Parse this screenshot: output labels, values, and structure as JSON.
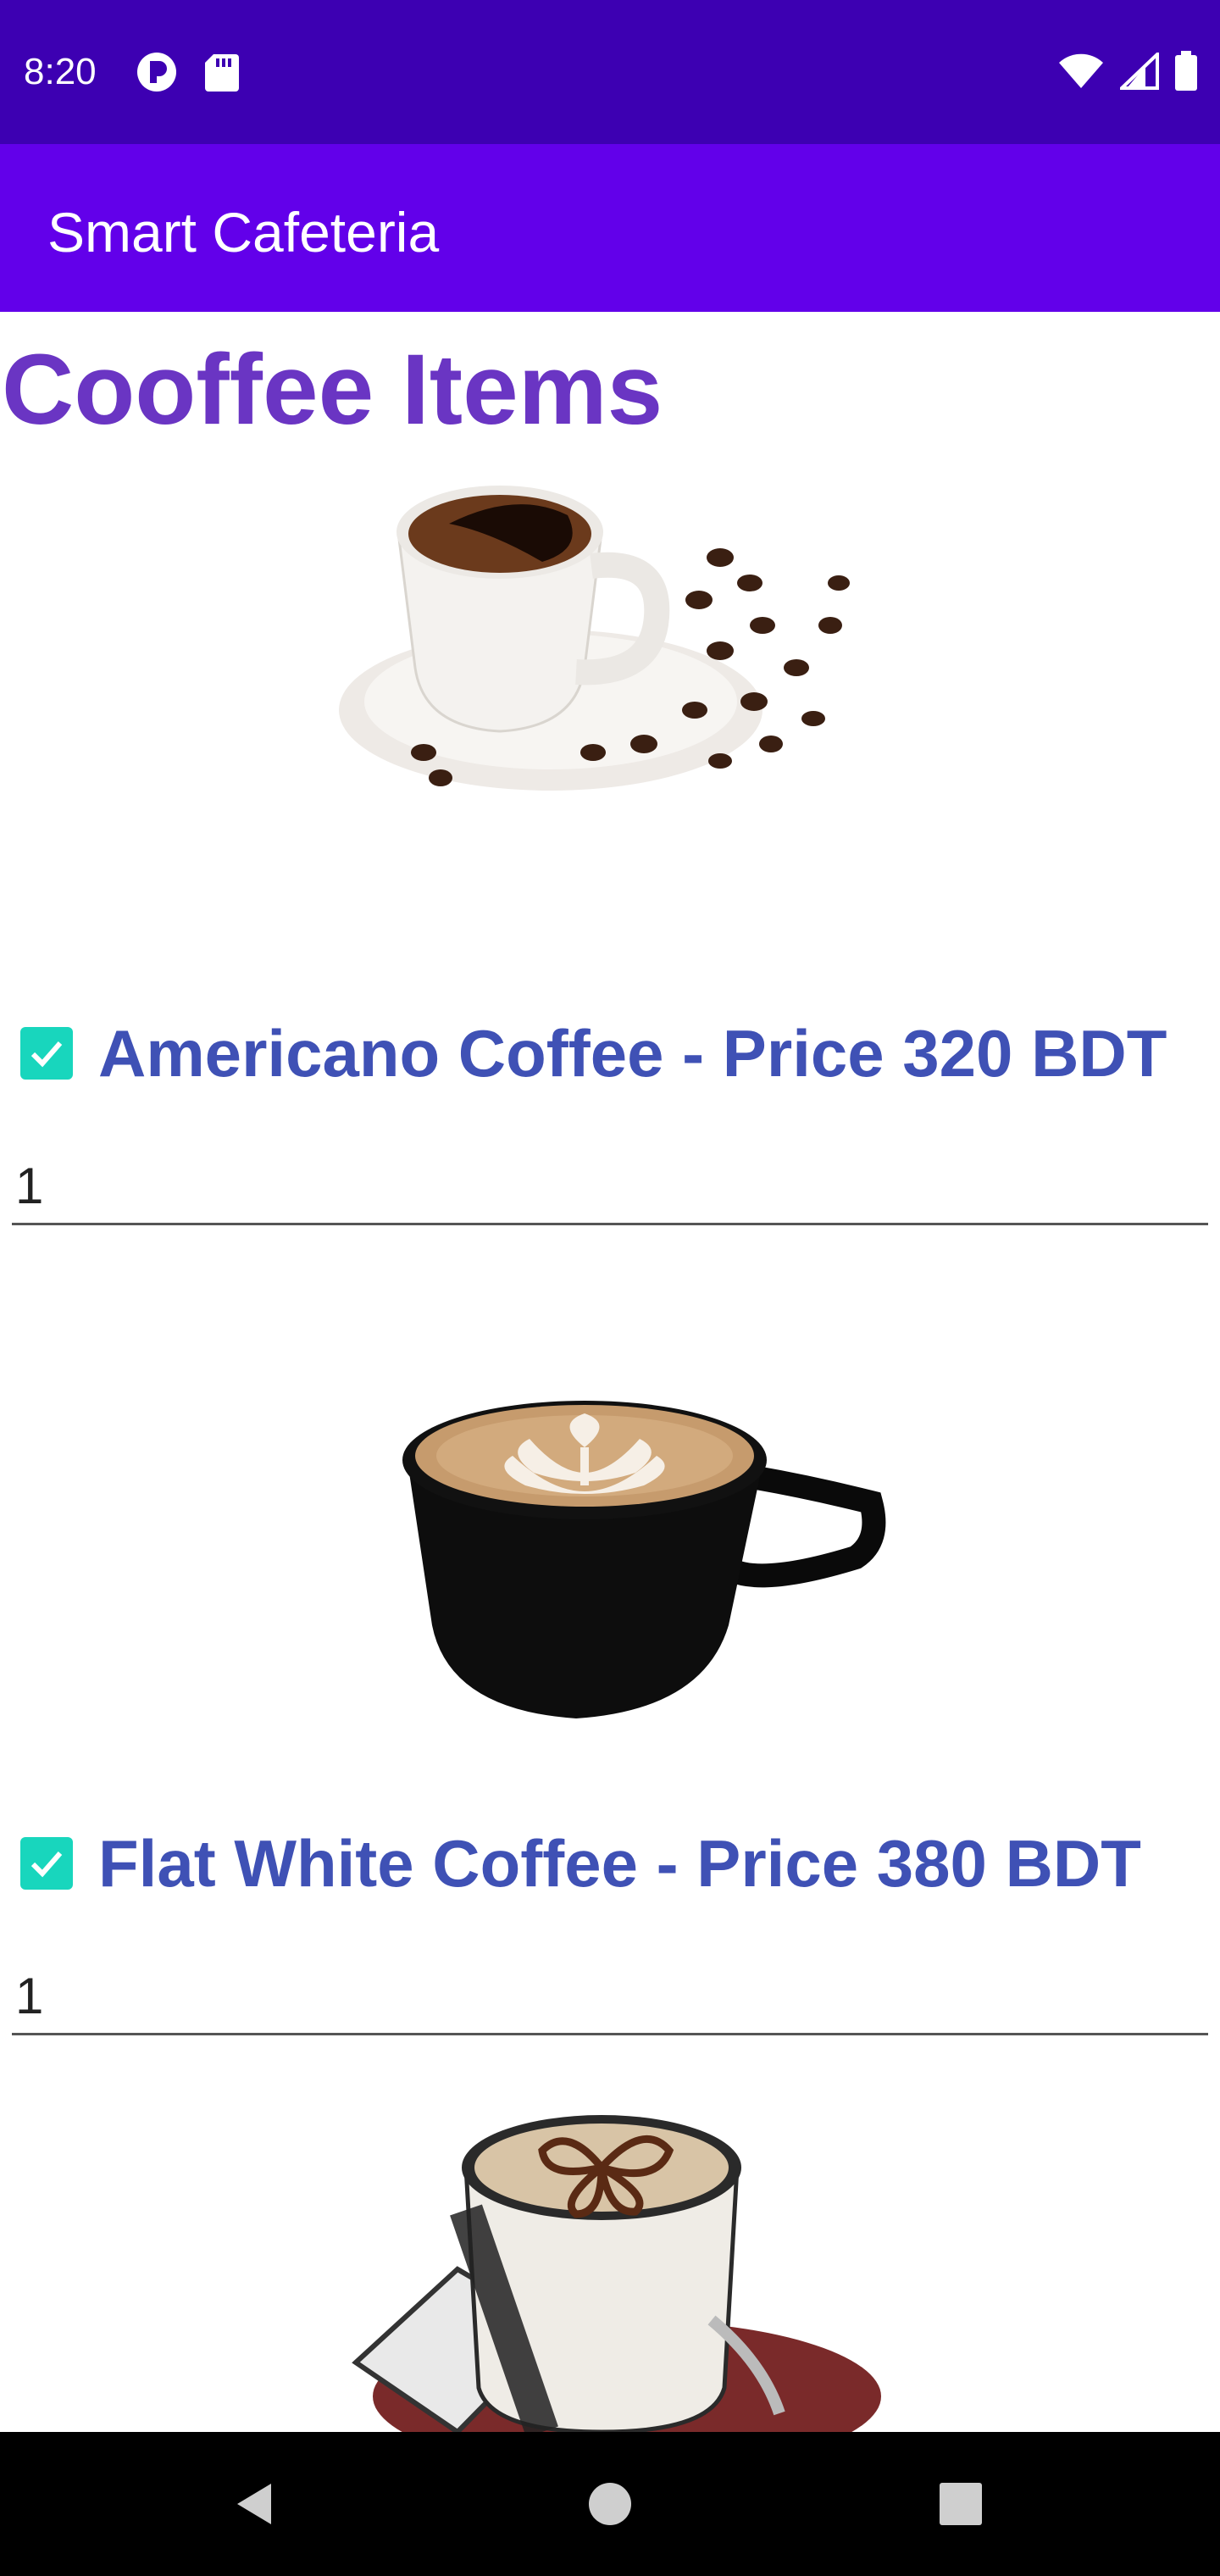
{
  "status_bar": {
    "time": "8:20",
    "left_icons": [
      "circle-p-icon",
      "sd-card-icon"
    ],
    "right_icons": [
      "wifi-icon",
      "cell-signal-icon",
      "battery-icon"
    ]
  },
  "app_bar": {
    "title": "Smart Cafeteria",
    "color": "#6200ea"
  },
  "section": {
    "title": "Cooffee Items"
  },
  "items": [
    {
      "label": "Americano Coffee - Price 320 BDT",
      "checked": true,
      "quantity": "1",
      "image": "americano-image"
    },
    {
      "label": "Flat White Coffee - Price 380 BDT",
      "checked": true,
      "quantity": "1",
      "image": "flat-white-image"
    },
    {
      "label": "",
      "checked": false,
      "quantity": "",
      "image": "cappuccino-image"
    }
  ],
  "nav_bar": {
    "buttons": [
      "back-icon",
      "home-icon",
      "recents-icon"
    ]
  },
  "colors": {
    "status_bar": "#3d00b2",
    "accent": "#18d6bd",
    "label": "#3f51b5",
    "title": "#6a35c3"
  }
}
